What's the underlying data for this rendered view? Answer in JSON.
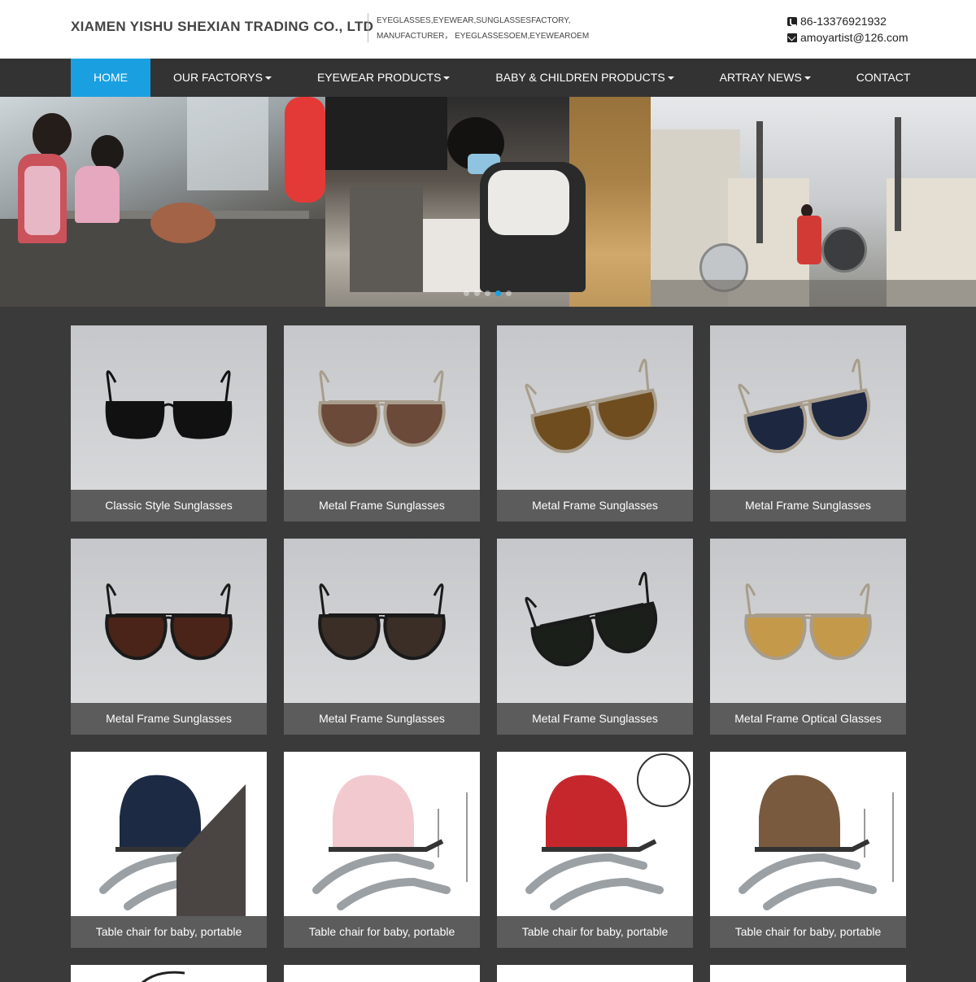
{
  "header": {
    "company_name": "XIAMEN YISHU SHEXIAN TRADING CO., LTD",
    "tagline_line1": "EYEGLASSES,EYEWEAR,SUNGLASSESFACTORY,",
    "tagline_line2": "MANUFACTURER， EYEGLASSESOEM,EYEWEAROEM",
    "phone": "86-13376921932",
    "email": "amoyartist@126.com",
    "phone_icon": "phone-icon",
    "email_icon": "envelope-icon"
  },
  "nav": {
    "items": [
      {
        "label": "HOME",
        "active": true,
        "dropdown": false
      },
      {
        "label": "OUR FACTORYS",
        "active": false,
        "dropdown": true
      },
      {
        "label": "EYEWEAR PRODUCTS",
        "active": false,
        "dropdown": true
      },
      {
        "label": "BABY & CHILDREN PRODUCTS",
        "active": false,
        "dropdown": true
      },
      {
        "label": "ARTRAY NEWS",
        "active": false,
        "dropdown": true
      },
      {
        "label": "CONTACT",
        "active": false,
        "dropdown": false
      }
    ],
    "active_color": "#1aa0e1"
  },
  "banner": {
    "slides": 5,
    "active_slide": 4
  },
  "products": [
    {
      "name": "Classic Style Sunglasses",
      "type": "sunglasses"
    },
    {
      "name": "Metal Frame Sunglasses",
      "type": "sunglasses"
    },
    {
      "name": "Metal Frame Sunglasses",
      "type": "sunglasses"
    },
    {
      "name": "Metal Frame Sunglasses",
      "type": "sunglasses"
    },
    {
      "name": "Metal Frame Sunglasses",
      "type": "sunglasses"
    },
    {
      "name": "Metal Frame Sunglasses",
      "type": "sunglasses"
    },
    {
      "name": "Metal Frame Sunglasses",
      "type": "sunglasses"
    },
    {
      "name": "Metal Frame Optical Glasses",
      "type": "sunglasses"
    },
    {
      "name": "Table chair for baby, portable",
      "type": "chair"
    },
    {
      "name": "Table chair for baby, portable",
      "type": "chair"
    },
    {
      "name": "Table chair for baby, portable",
      "type": "chair"
    },
    {
      "name": "Table chair for baby, portable",
      "type": "chair"
    }
  ]
}
